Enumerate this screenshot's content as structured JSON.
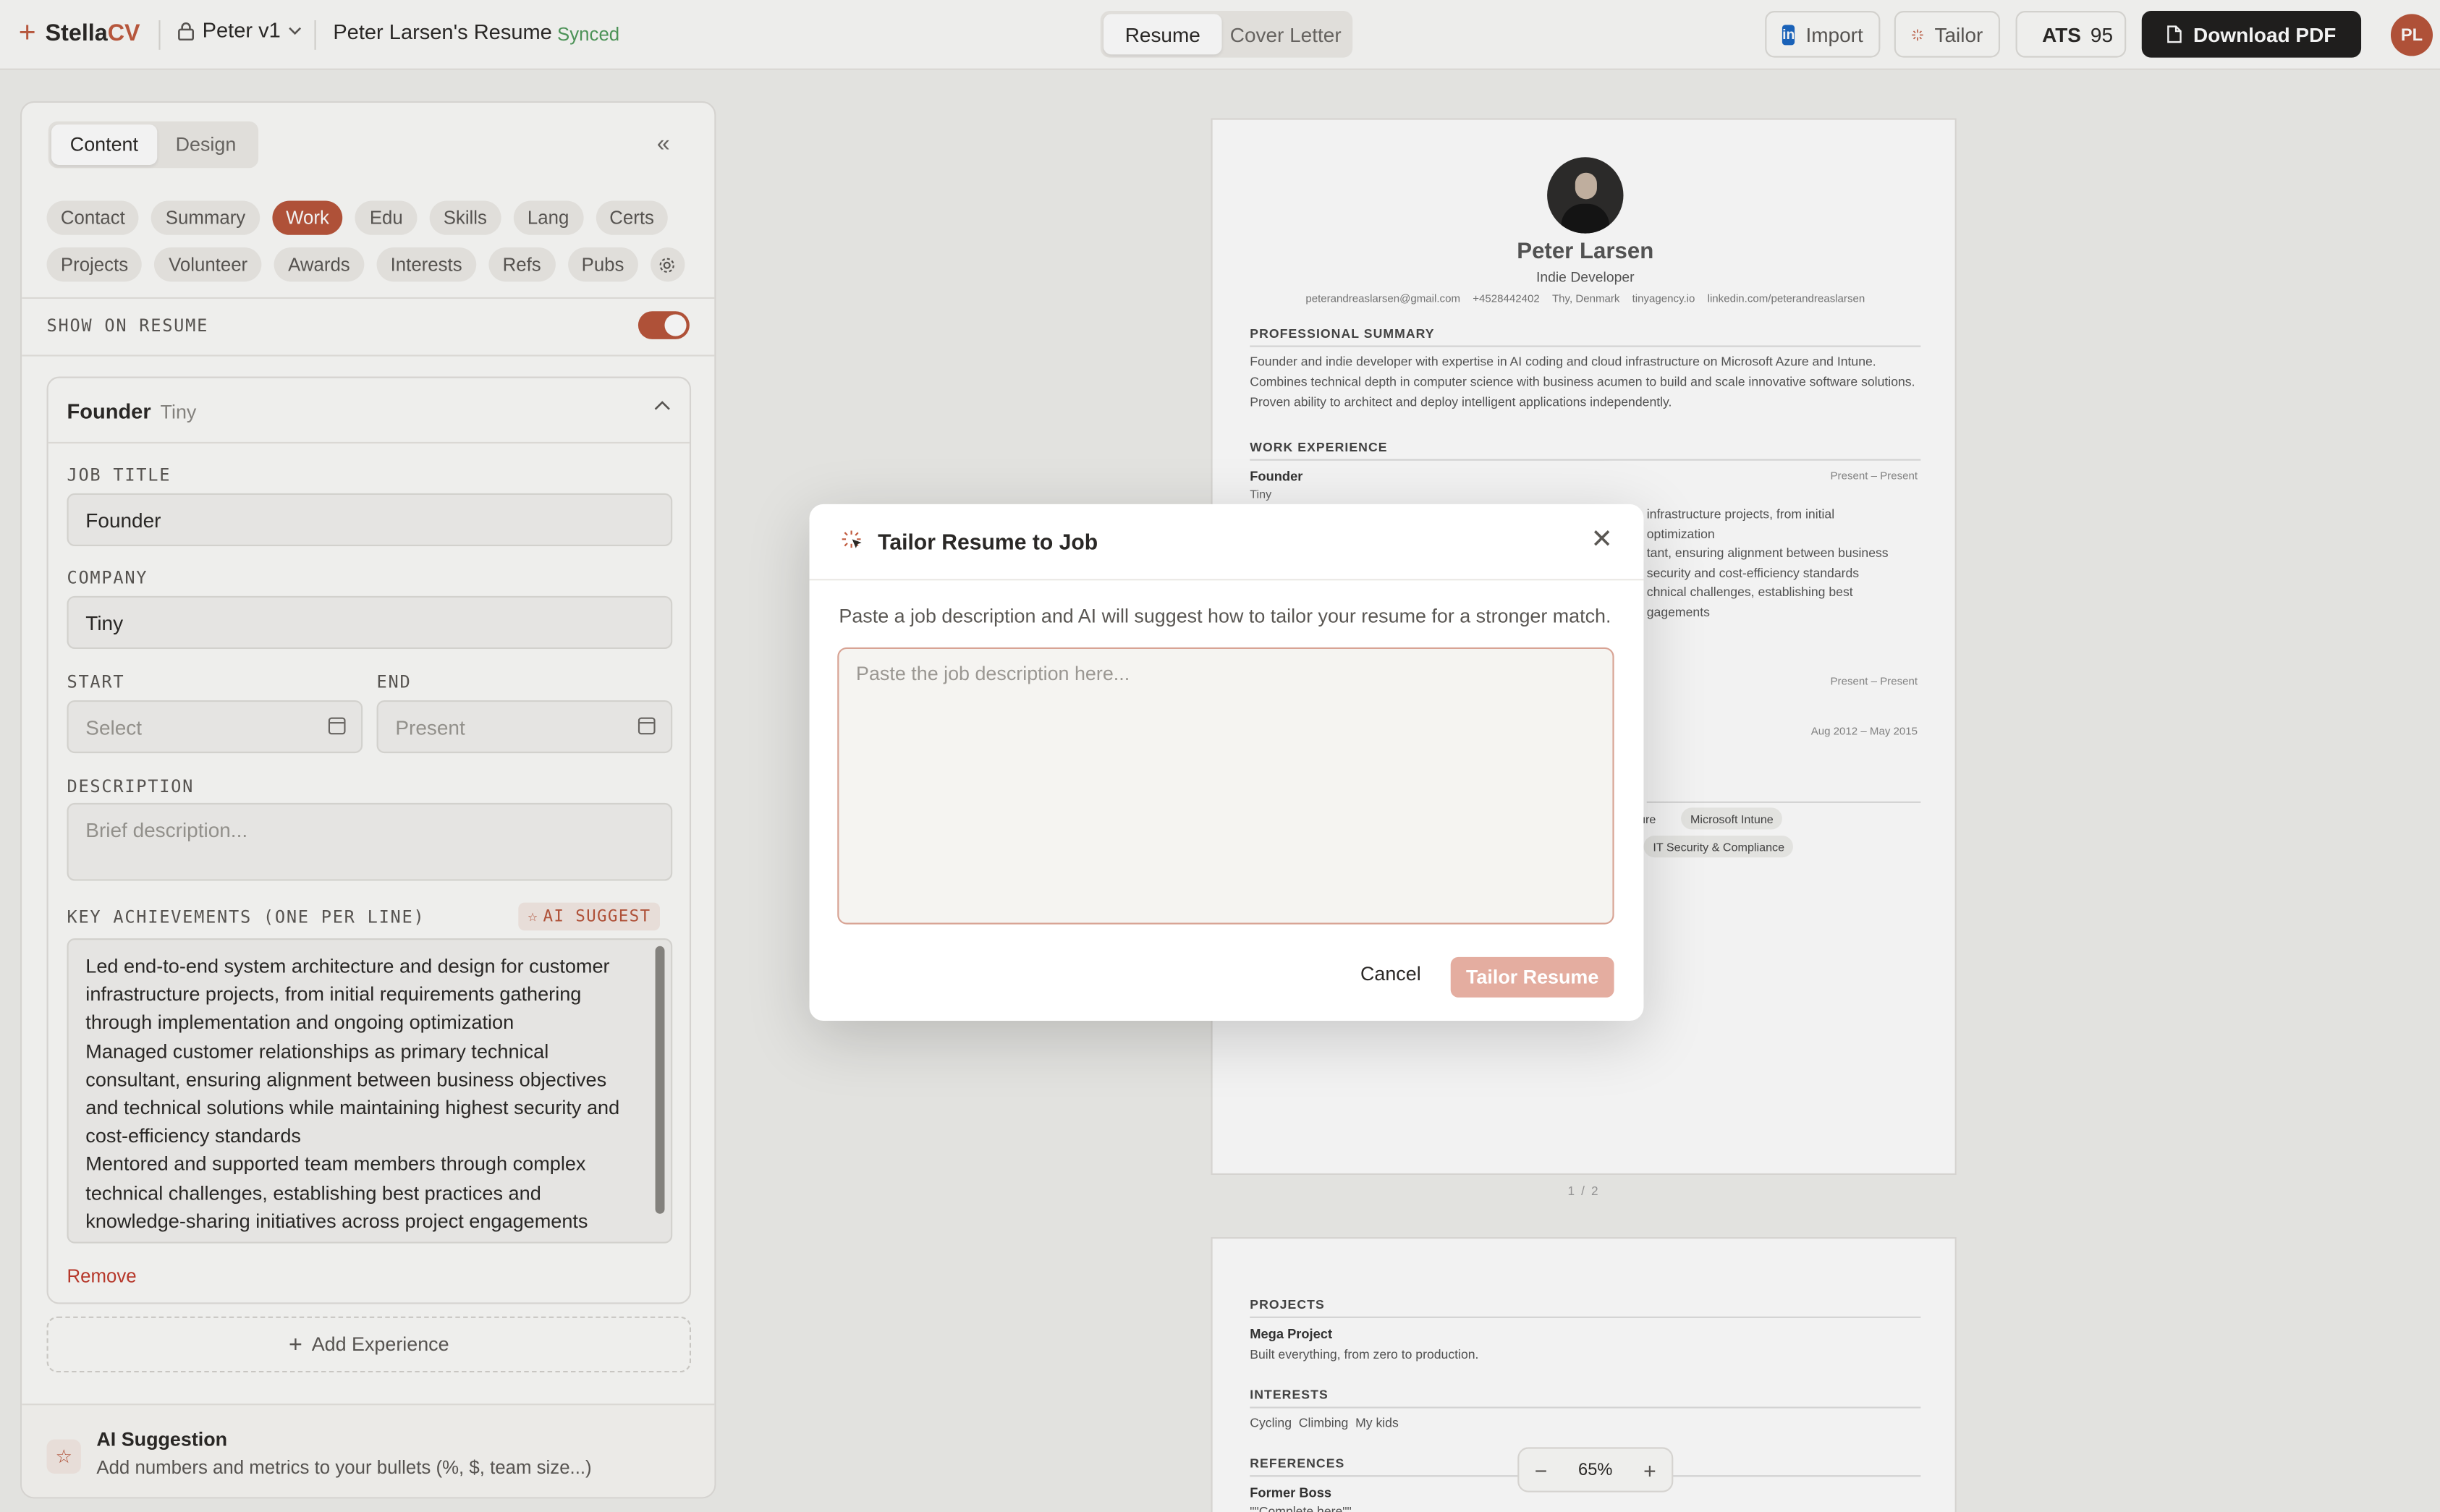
{
  "app": {
    "logo_prefix": "Stella",
    "logo_suffix": "CV",
    "profile": "Peter v1",
    "doc_title": "Peter Larsen's Resume",
    "sync_status": "Synced"
  },
  "top_tabs": [
    "Resume",
    "Cover Letter"
  ],
  "toolbar": {
    "import": "Import",
    "tailor": "Tailor",
    "ats_label": "ATS",
    "ats_score": "95",
    "download": "Download PDF",
    "avatar": "PL"
  },
  "panel": {
    "tabs": [
      "Content",
      "Design"
    ],
    "sections_row1": [
      "Contact",
      "Summary",
      "Work",
      "Edu",
      "Skills",
      "Lang",
      "Certs"
    ],
    "sections_row2": [
      "Projects",
      "Volunteer",
      "Awards",
      "Interests",
      "Refs",
      "Pubs"
    ],
    "active_section": "Work",
    "show_on_resume": "SHOW ON RESUME",
    "entry": {
      "title": "Founder",
      "company_hint": "Tiny",
      "job_title_label": "JOB TITLE",
      "job_title_value": "Founder",
      "company_label": "COMPANY",
      "company_value": "Tiny",
      "start_label": "START",
      "start_placeholder": "Select",
      "end_label": "END",
      "end_placeholder": "Present",
      "description_label": "DESCRIPTION",
      "description_placeholder": "Brief description...",
      "achievements_label": "KEY ACHIEVEMENTS (ONE PER LINE)",
      "ai_suggest": "AI SUGGEST",
      "achievements": "Led end-to-end system architecture and design for customer infrastructure projects, from initial requirements gathering through implementation and ongoing optimization\nManaged customer relationships as primary technical consultant, ensuring alignment between business objectives and technical solutions while maintaining highest security and cost-efficiency standards\nMentored and supported team members through complex technical challenges, establishing best practices and knowledge-sharing initiatives across project engagements",
      "remove": "Remove"
    },
    "add_experience": "Add Experience",
    "suggestion": {
      "title": "AI Suggestion",
      "text": "Add numbers and metrics to your bullets (%, $, team size...)"
    }
  },
  "resume": {
    "name": "Peter Larsen",
    "role": "Indie Developer",
    "contact": [
      "peterandreaslarsen@gmail.com",
      "+4528442402",
      "Thy, Denmark",
      "tinyagency.io",
      "linkedin.com/peterandreaslarsen"
    ],
    "summary_heading": "PROFESSIONAL SUMMARY",
    "summary": "Founder and indie developer with expertise in AI coding and cloud infrastructure on Microsoft Azure and Intune. Combines technical depth in computer science with business acumen to build and scale innovative software solutions. Proven ability to architect and deploy intelligent applications independently.",
    "work_heading": "WORK EXPERIENCE",
    "job1_title": "Founder",
    "job1_company": "Tiny",
    "job1_dates": "Present – Present",
    "visible_fragments": [
      "infrastructure projects, from initial",
      "optimization",
      "tant, ensuring alignment between business",
      "security and cost-efficiency standards",
      "chnical challenges, establishing best",
      "gagements"
    ],
    "job2_dates": "Present – Present",
    "job3_dates": "Aug 2012 – May 2015",
    "skill_tags": [
      "ure",
      "Microsoft Intune",
      "IT Security & Compliance"
    ],
    "page_indicator": "1 / 2",
    "projects_heading": "PROJECTS",
    "project_name": "Mega Project",
    "project_desc": "Built everything, from zero to production.",
    "interests_heading": "INTERESTS",
    "interests": "Cycling  Climbing  My kids",
    "references_heading": "REFERENCES",
    "reference_name": "Former Boss",
    "reference_quote": "\"\"Complete here\"\""
  },
  "zoom": {
    "value": "65%"
  },
  "modal": {
    "title": "Tailor Resume to Job",
    "description": "Paste a job description and AI will suggest how to tailor your resume for a stronger match.",
    "placeholder": "Paste the job description here...",
    "cancel": "Cancel",
    "submit": "Tailor Resume"
  },
  "colors": {
    "accent": "#b8543a",
    "synced": "#4f9a5b",
    "dark_button": "#1f1e1d"
  }
}
